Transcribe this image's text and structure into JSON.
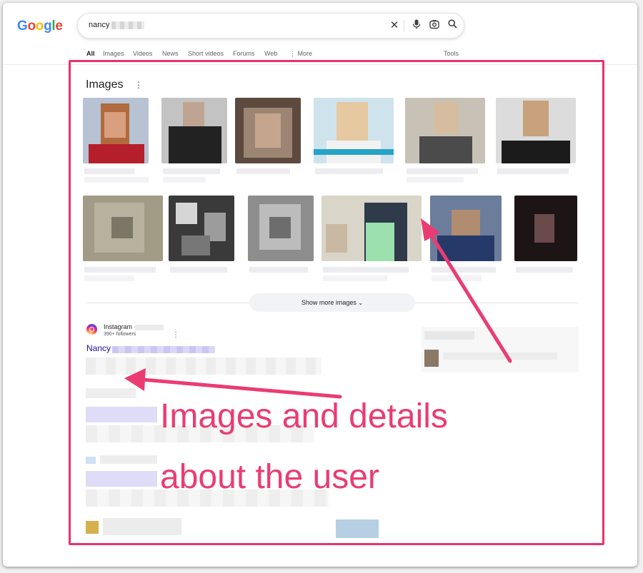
{
  "logo": {
    "letters": [
      "G",
      "o",
      "o",
      "g",
      "l",
      "e"
    ],
    "colors": [
      "#4285F4",
      "#EA4335",
      "#FBBC05",
      "#4285F4",
      "#34A853",
      "#EA4335"
    ]
  },
  "search": {
    "query": "nancy"
  },
  "tabs": [
    "All",
    "Images",
    "Videos",
    "News",
    "Short videos",
    "Forums",
    "Web"
  ],
  "more_label": "More",
  "tools_label": "Tools",
  "images_section": {
    "title": "Images",
    "show_more": "Show more images"
  },
  "result": {
    "source": "Instagram ·",
    "followers": "390+ followers",
    "title": "Nancy"
  },
  "annotation": {
    "line1": "Images and details",
    "line2": "about the user",
    "color": "#ea3c73"
  },
  "colors": {
    "highlight_border": "#e8336d",
    "link": "#1a0dab"
  }
}
